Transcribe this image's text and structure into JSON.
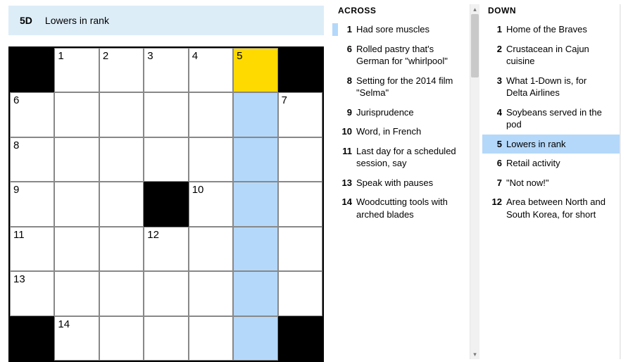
{
  "cluebar": {
    "num": "5D",
    "text": "Lowers in rank"
  },
  "grid": {
    "size": 7,
    "cells": [
      [
        "#",
        "1",
        "2",
        "3",
        "4",
        "5*",
        "#"
      ],
      [
        "6",
        ".",
        ".",
        ".",
        ".",
        "+",
        "7"
      ],
      [
        "8",
        ".",
        ".",
        ".",
        ".",
        "+",
        "."
      ],
      [
        "9",
        ".",
        ".",
        "#",
        "10",
        "+",
        "."
      ],
      [
        "11",
        ".",
        ".",
        "12",
        ".",
        "+",
        "."
      ],
      [
        "13",
        ".",
        ".",
        ".",
        ".",
        "+",
        "."
      ],
      [
        "#",
        "14",
        ".",
        ".",
        ".",
        "+",
        "#"
      ]
    ]
  },
  "across": {
    "title": "ACROSS",
    "clues": [
      {
        "n": "1",
        "t": "Had sore muscles",
        "barred": true
      },
      {
        "n": "6",
        "t": "Rolled pastry that's German for \"whirlpool\""
      },
      {
        "n": "8",
        "t": "Setting for the 2014 film \"Selma\""
      },
      {
        "n": "9",
        "t": "Jurisprudence"
      },
      {
        "n": "10",
        "t": "Word, in French"
      },
      {
        "n": "11",
        "t": "Last day for a scheduled session, say"
      },
      {
        "n": "13",
        "t": "Speak with pauses"
      },
      {
        "n": "14",
        "t": "Woodcutting tools with arched blades"
      }
    ]
  },
  "down": {
    "title": "DOWN",
    "clues": [
      {
        "n": "1",
        "t": "Home of the Braves"
      },
      {
        "n": "2",
        "t": "Crustacean in Cajun cuisine"
      },
      {
        "n": "3",
        "t": "What 1-Down is, for Delta Airlines"
      },
      {
        "n": "4",
        "t": "Soybeans served in the pod"
      },
      {
        "n": "5",
        "t": "Lowers in rank",
        "selected": true
      },
      {
        "n": "6",
        "t": "Retail activity"
      },
      {
        "n": "7",
        "t": "\"Not now!\""
      },
      {
        "n": "12",
        "t": "Area between North and South Korea, for short"
      }
    ]
  }
}
